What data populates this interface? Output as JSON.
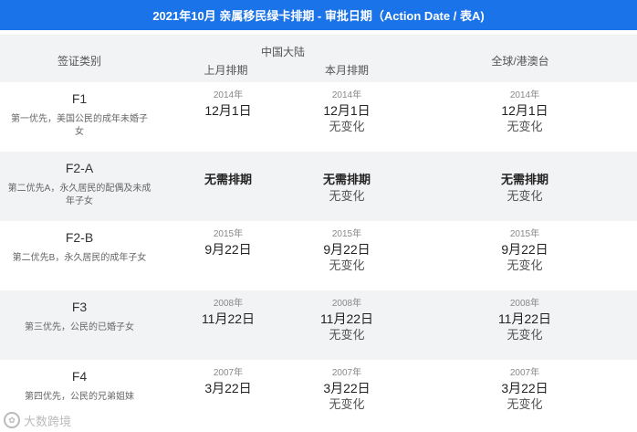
{
  "title": "2021年10月 亲属移民绿卡排期 - 审批日期（Action Date / 表A)",
  "header": {
    "category": "签证类别",
    "mainland": "中国大陆",
    "prev_month": "上月排期",
    "curr_month": "本月排期",
    "global": "全球/港澳台"
  },
  "rows": [
    {
      "name": "F1",
      "desc": "第一优先，美国公民的成年未婚子女",
      "prev": {
        "year": "2014年",
        "date": "12月1日"
      },
      "curr": {
        "year": "2014年",
        "date": "12月1日",
        "note": "无变化"
      },
      "glob": {
        "year": "2014年",
        "date": "12月1日",
        "note": "无变化"
      }
    },
    {
      "name": "F2-A",
      "desc": "第二优先A，永久居民的配偶及未成年子女",
      "prev": {
        "main": "无需排期"
      },
      "curr": {
        "main": "无需排期",
        "note": "无变化"
      },
      "glob": {
        "main": "无需排期",
        "note": "无变化"
      }
    },
    {
      "name": "F2-B",
      "desc": "第二优先B，永久居民的成年子女",
      "prev": {
        "year": "2015年",
        "date": "9月22日"
      },
      "curr": {
        "year": "2015年",
        "date": "9月22日",
        "note": "无变化"
      },
      "glob": {
        "year": "2015年",
        "date": "9月22日",
        "note": "无变化"
      }
    },
    {
      "name": "F3",
      "desc": "第三优先，公民的已婚子女",
      "prev": {
        "year": "2008年",
        "date": "11月22日"
      },
      "curr": {
        "year": "2008年",
        "date": "11月22日",
        "note": "无变化"
      },
      "glob": {
        "year": "2008年",
        "date": "11月22日",
        "note": "无变化"
      }
    },
    {
      "name": "F4",
      "desc": "第四优先，公民的兄弟姐妹",
      "prev": {
        "year": "2007年",
        "date": "3月22日"
      },
      "curr": {
        "year": "2007年",
        "date": "3月22日",
        "note": "无变化"
      },
      "glob": {
        "year": "2007年",
        "date": "3月22日",
        "note": "无变化"
      }
    }
  ],
  "watermark": {
    "text": "大数跨境",
    "icon": "logo-icon"
  },
  "colors": {
    "title_bg": "#1a73e8",
    "alt_row": "#f2f3f5"
  }
}
